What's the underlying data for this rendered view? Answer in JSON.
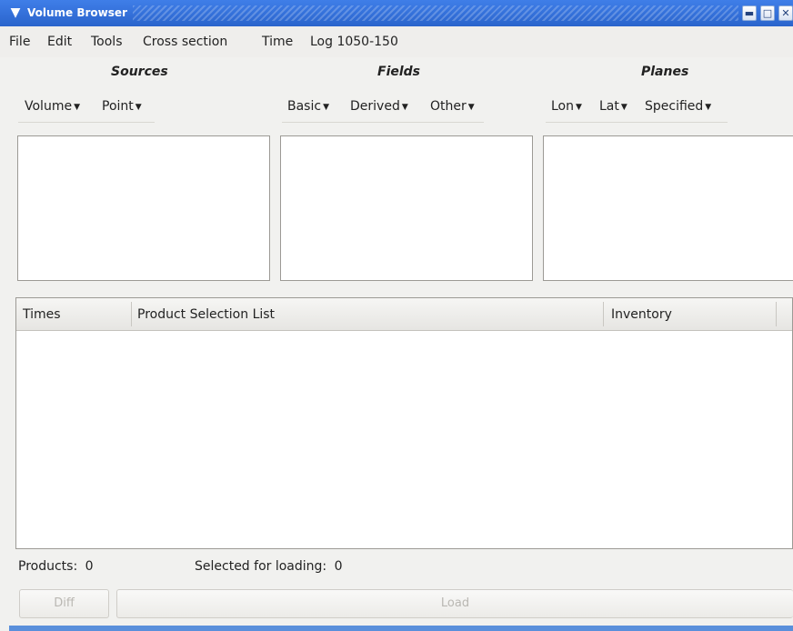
{
  "window": {
    "title": "Volume Browser",
    "icon": "chevron-down-icon",
    "controls": [
      "minimize-icon",
      "maximize-icon",
      "close-icon"
    ]
  },
  "menubar": {
    "items": [
      "File",
      "Edit",
      "Tools",
      "Cross section",
      "Time",
      "Log 1050-150"
    ]
  },
  "sections": {
    "sources": {
      "title": "Sources",
      "dropdowns": [
        "Volume",
        "Point"
      ]
    },
    "fields": {
      "title": "Fields",
      "dropdowns": [
        "Basic",
        "Derived",
        "Other"
      ]
    },
    "planes": {
      "title": "Planes",
      "dropdowns": [
        "Lon",
        "Lat",
        "Specified"
      ]
    }
  },
  "table": {
    "columns": [
      "Times",
      "Product Selection List",
      "Inventory"
    ],
    "rows": []
  },
  "status": {
    "products_label": "Products:",
    "products_count": "0",
    "selected_label": "Selected for loading:",
    "selected_count": "0"
  },
  "buttons": {
    "diff": "Diff",
    "load": "Load"
  },
  "colors": {
    "titlebar": "#2f6fdc",
    "window_bg": "#f1f1ef",
    "disabled_text": "#b9b7b2"
  }
}
